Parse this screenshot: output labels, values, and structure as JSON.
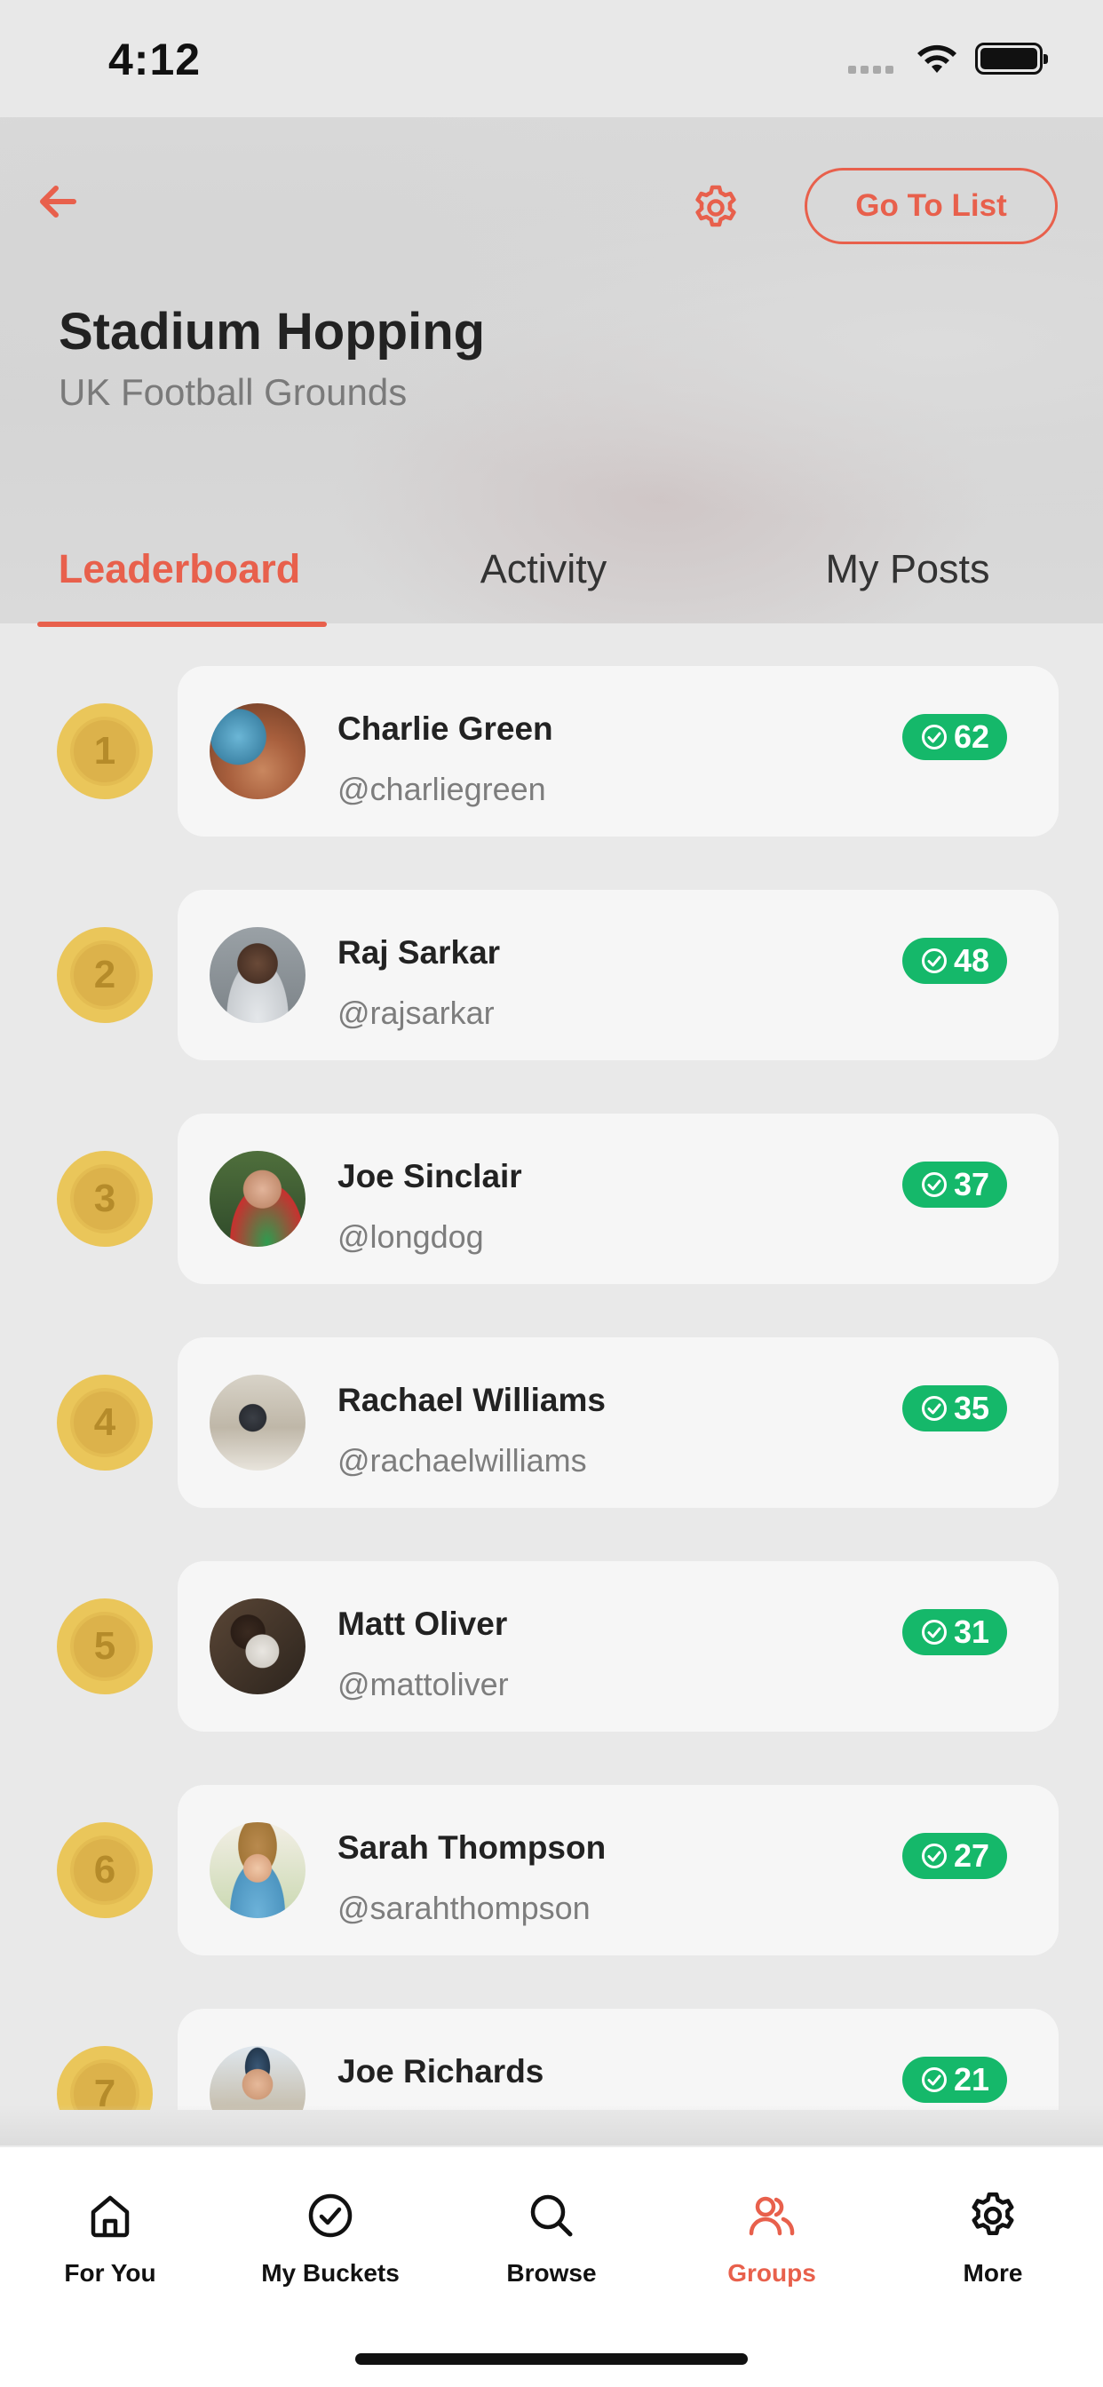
{
  "status_bar": {
    "time": "4:12"
  },
  "header": {
    "title": "Stadium Hopping",
    "subtitle": "UK Football Grounds",
    "go_to_list_label": "Go To List",
    "accent_color": "#e8604c"
  },
  "tabs": [
    {
      "label": "Leaderboard",
      "active": true
    },
    {
      "label": "Activity",
      "active": false
    },
    {
      "label": "My Posts",
      "active": false
    }
  ],
  "leaderboard": [
    {
      "rank": "1",
      "name": "Charlie Green",
      "handle": "@charliegreen",
      "score": "62"
    },
    {
      "rank": "2",
      "name": "Raj Sarkar",
      "handle": "@rajsarkar",
      "score": "48"
    },
    {
      "rank": "3",
      "name": "Joe Sinclair",
      "handle": "@longdog",
      "score": "37"
    },
    {
      "rank": "4",
      "name": "Rachael Williams",
      "handle": "@rachaelwilliams",
      "score": "35"
    },
    {
      "rank": "5",
      "name": "Matt Oliver",
      "handle": "@mattoliver",
      "score": "31"
    },
    {
      "rank": "6",
      "name": "Sarah Thompson",
      "handle": "@sarahthompson",
      "score": "27"
    },
    {
      "rank": "7",
      "name": "Joe Richards",
      "handle": "",
      "score": "21"
    }
  ],
  "score_badge_color": "#15b86a",
  "medal_color": "#eac65a",
  "bottom_nav": [
    {
      "label": "For You",
      "icon": "home-icon",
      "active": false
    },
    {
      "label": "My Buckets",
      "icon": "check-circle-icon",
      "active": false
    },
    {
      "label": "Browse",
      "icon": "search-icon",
      "active": false
    },
    {
      "label": "Groups",
      "icon": "groups-icon",
      "active": true
    },
    {
      "label": "More",
      "icon": "gear-icon",
      "active": false
    }
  ]
}
